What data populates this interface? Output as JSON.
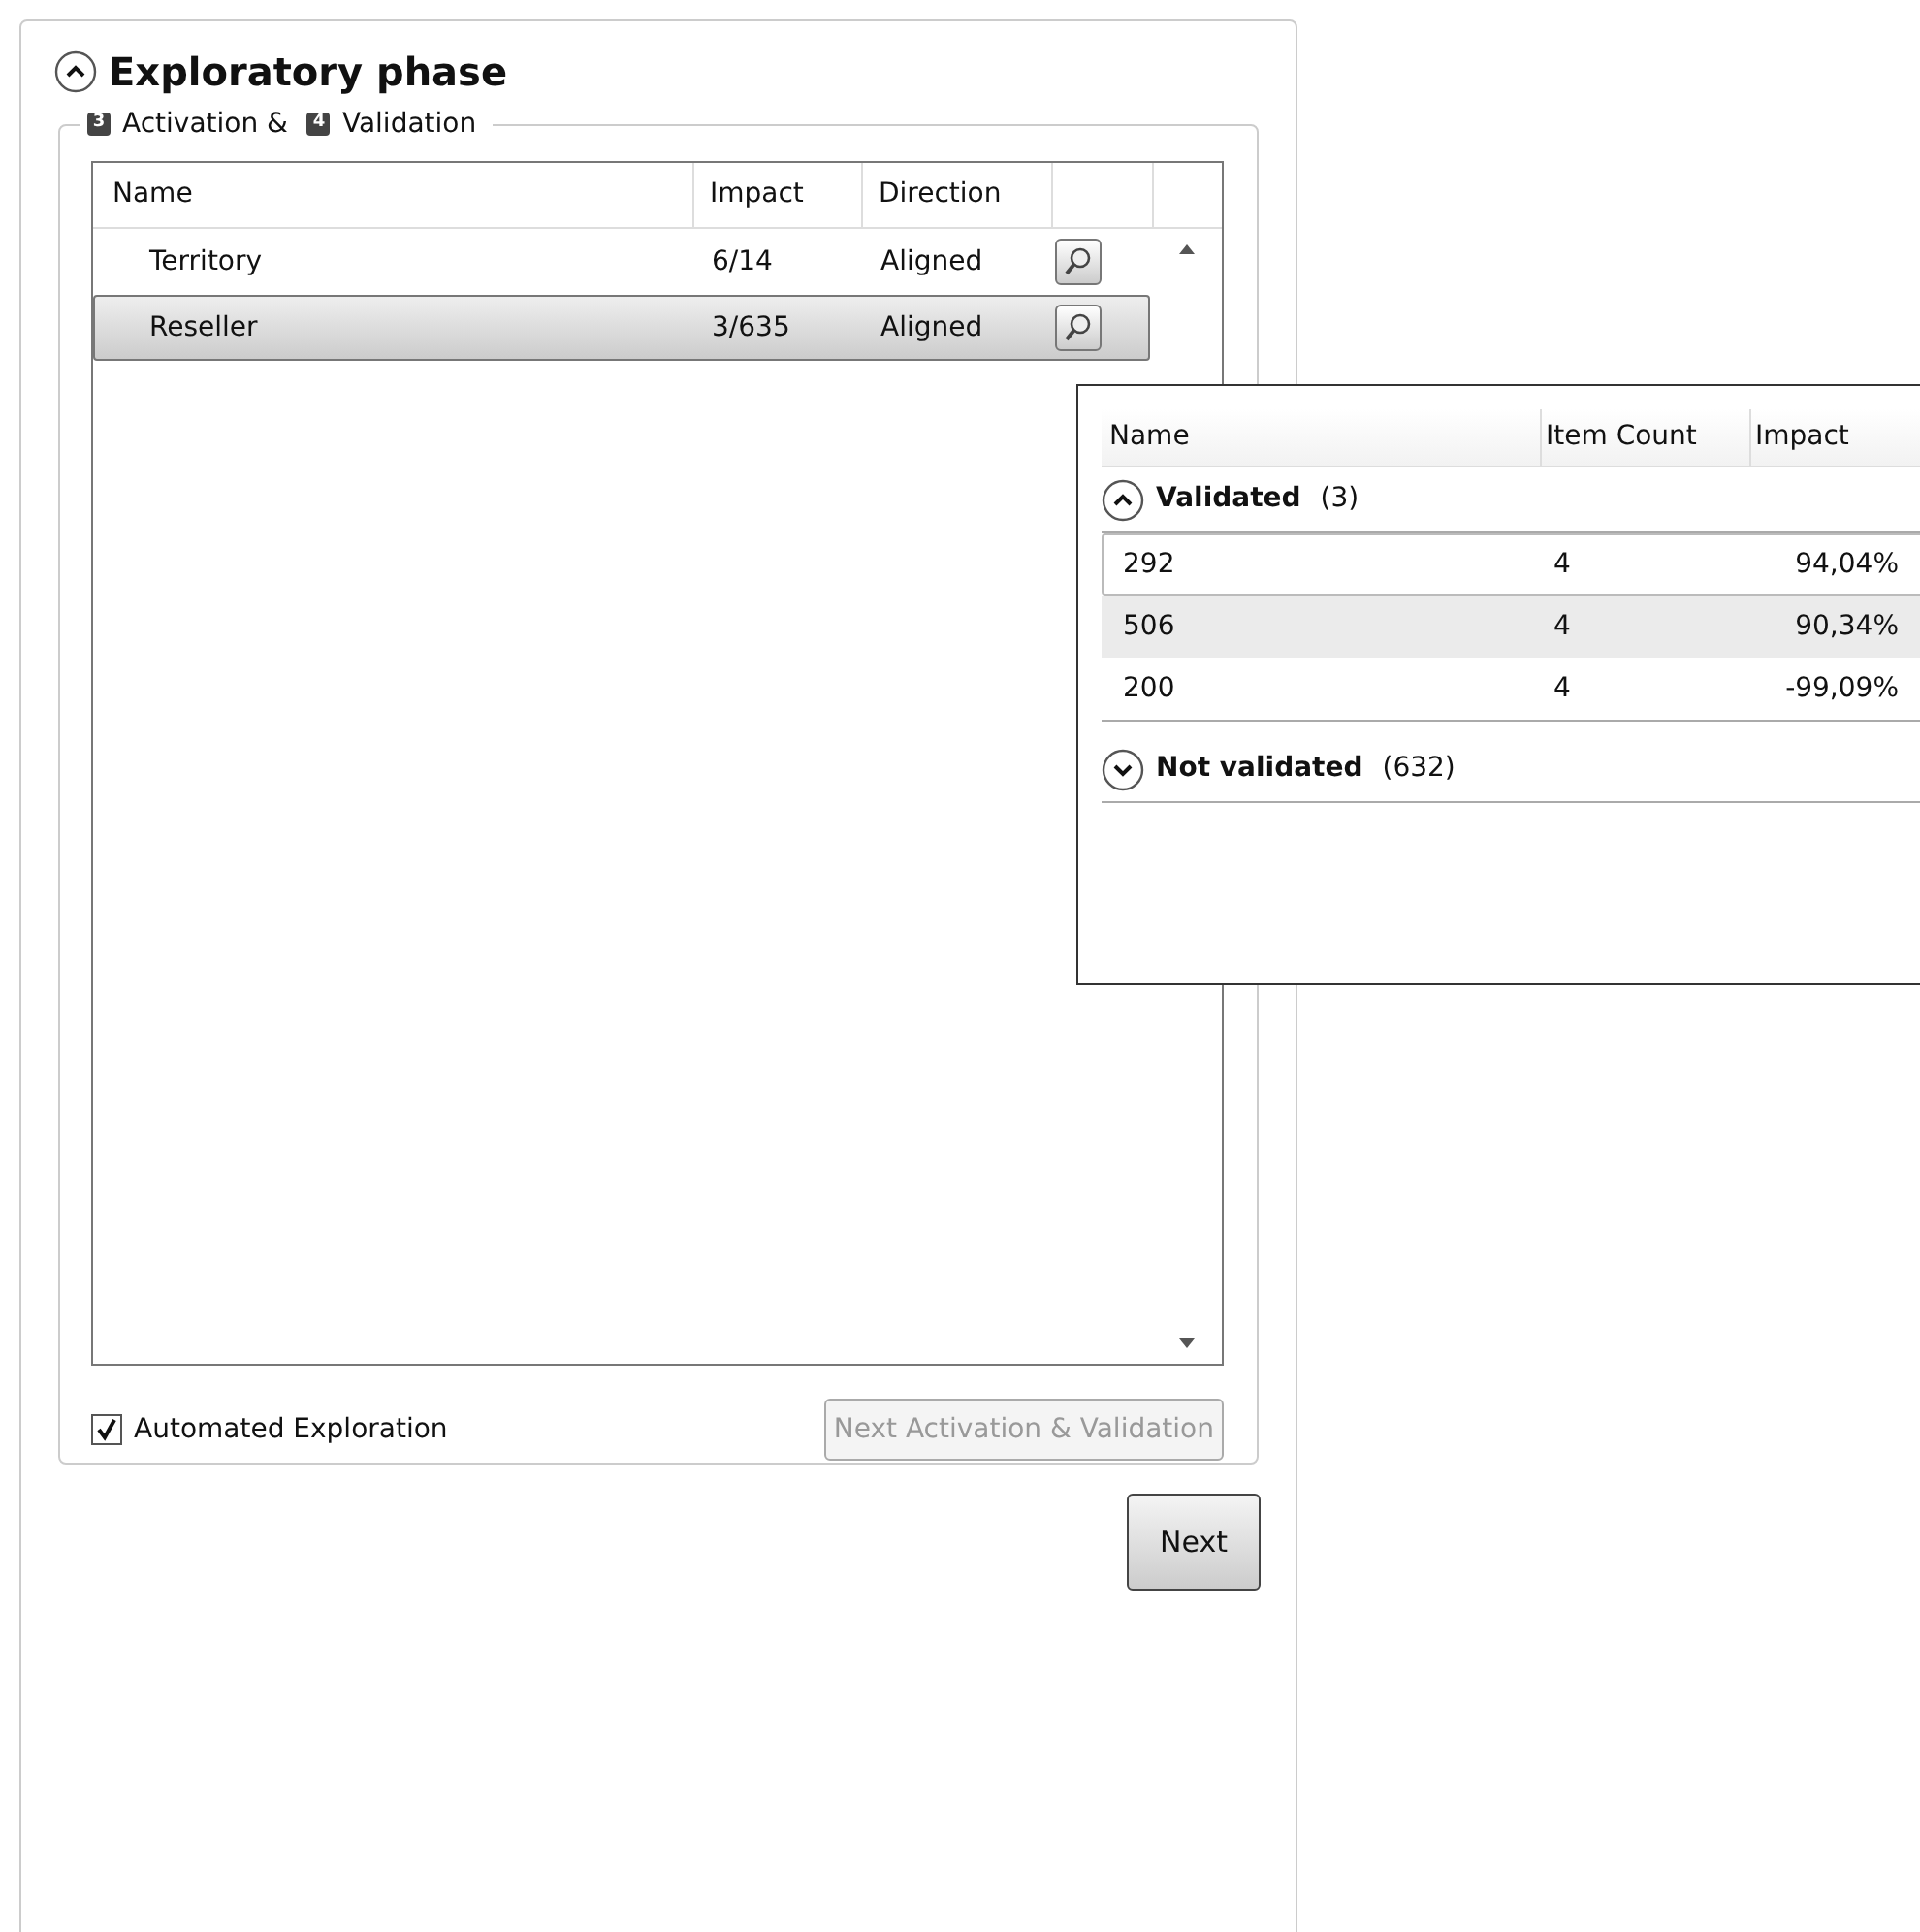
{
  "section": {
    "title": "Exploratory phase",
    "expanded": true
  },
  "group": {
    "steps": [
      {
        "number": "3",
        "label": "Activation &"
      },
      {
        "number": "4",
        "label": "Validation"
      }
    ]
  },
  "table": {
    "columns": [
      "Name",
      "Impact",
      "Direction"
    ],
    "rows": [
      {
        "name": "Territory",
        "impact": "6/14",
        "direction": "Aligned",
        "selected": false
      },
      {
        "name": "Reseller",
        "impact": "3/635",
        "direction": "Aligned",
        "selected": true
      }
    ]
  },
  "popup": {
    "columns": [
      "Name",
      "Item Count",
      "Impact"
    ],
    "groups": [
      {
        "title": "Validated",
        "count": "(3)",
        "expanded": true,
        "rows": [
          {
            "name": "292",
            "item_count": "4",
            "impact": "94,04%",
            "focused": true,
            "highlighted": false
          },
          {
            "name": "506",
            "item_count": "4",
            "impact": "90,34%",
            "focused": false,
            "highlighted": true
          },
          {
            "name": "200",
            "item_count": "4",
            "impact": "-99,09%",
            "focused": false,
            "highlighted": false
          }
        ]
      },
      {
        "title": "Not validated",
        "count": "(632)",
        "expanded": false
      }
    ]
  },
  "automated_exploration": {
    "label": "Automated Exploration",
    "checked": true
  },
  "next_activation_button": {
    "label": "Next Activation & Validation",
    "disabled": true
  },
  "next_button": {
    "label": "Next"
  }
}
